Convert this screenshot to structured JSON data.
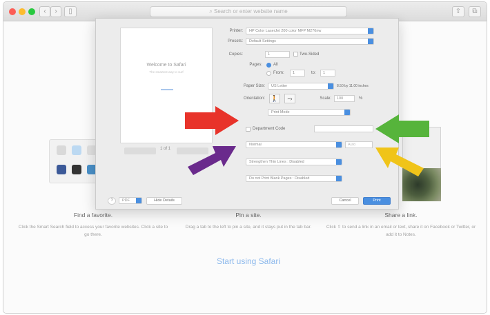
{
  "browser": {
    "address_placeholder": "Search or enter website name",
    "nav_back": "‹",
    "nav_forward": "›",
    "sidebar_glyph": "▯"
  },
  "new_tab": {
    "features": [
      {
        "title": "Find a favorite.",
        "text": "Click the Smart Search field to access your favorite websites. Click a site to go there."
      },
      {
        "title": "Pin a site.",
        "text": "Drag a tab to the left to pin a site, and it stays put in the tab bar."
      },
      {
        "title": "Share a link.",
        "text": "Click ⇧ to send a link in an email or text, share it on Facebook or Twitter, or add it to Notes."
      }
    ],
    "start_link": "Start using Safari"
  },
  "print_dialog": {
    "preview": {
      "title": "Welcome to Safari",
      "subtitle": "The smartest way to surf"
    },
    "page_count": "1 of 1",
    "printer": {
      "label": "Printer:",
      "value": "HP Color LaserJet 200 color MFP M276nw"
    },
    "presets": {
      "label": "Presets:",
      "value": "Default Settings"
    },
    "copies": {
      "label": "Copies:",
      "value": "1",
      "two_sided": "Two-Sided"
    },
    "pages": {
      "label": "Pages:",
      "all": "All",
      "from_label": "From:",
      "from_value": "1",
      "to_label": "to:",
      "to_value": "1"
    },
    "paper_size": {
      "label": "Paper Size:",
      "value": "US Letter",
      "dims": "8.50 by 11.00 inches"
    },
    "orientation": {
      "label": "Orientation:",
      "portrait_glyph": "🚶",
      "landscape_glyph": "⤳"
    },
    "scale": {
      "label": "Scale:",
      "value": "100",
      "unit": "%"
    },
    "section_popup": "Print Mode",
    "department_code": {
      "label": "Department Code"
    },
    "mode_popup": "Normal",
    "mode_right_field": "Auto",
    "thin_lines_popup": "Strengthen Thin Lines : Disabled",
    "blank_pages_popup": "Do not Print Blank Pages : Disabled",
    "help": "?",
    "pdf_button": "PDF",
    "hide_details": "Hide Details",
    "cancel": "Cancel",
    "print": "Print"
  },
  "colors": {
    "accent": "#4a8fe0",
    "arrow_red": "#e8332a",
    "arrow_green": "#56b43b",
    "arrow_purple": "#6a2a8c",
    "arrow_yellow": "#f0c419"
  }
}
